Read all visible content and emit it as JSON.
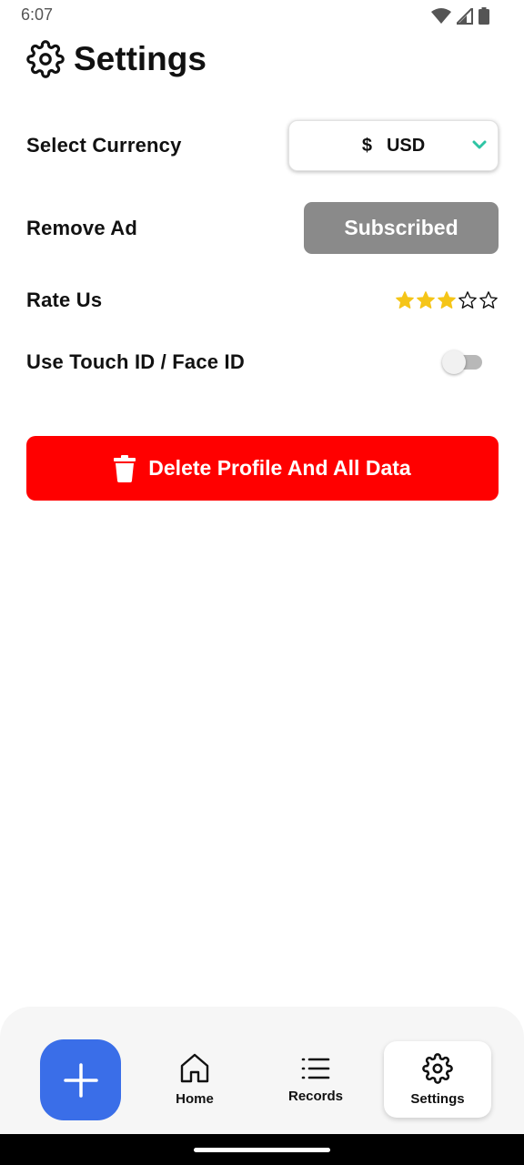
{
  "status_bar": {
    "time": "6:07",
    "icons": [
      "wifi-icon",
      "signal-icon",
      "battery-icon"
    ]
  },
  "header": {
    "icon": "gear-icon",
    "title": "Settings"
  },
  "settings": {
    "currency": {
      "label": "Select Currency",
      "symbol": "$",
      "code": "USD",
      "chevron_color": "#2ec4a4"
    },
    "remove_ad": {
      "label": "Remove Ad",
      "button_label": "Subscribed"
    },
    "rate_us": {
      "label": "Rate Us",
      "rating": 3,
      "max_rating": 5,
      "star_color": "#f5c518"
    },
    "touch_id": {
      "label": "Use Touch ID / Face ID",
      "enabled": false
    }
  },
  "delete_button": {
    "icon": "trash-icon",
    "label": "Delete Profile And All Data",
    "color": "#ff0000"
  },
  "bottom_nav": {
    "fab_icon": "plus-icon",
    "fab_color": "#3a6ee8",
    "items": [
      {
        "label": "Home",
        "icon": "home-icon",
        "active": false
      },
      {
        "label": "Records",
        "icon": "list-icon",
        "active": false
      },
      {
        "label": "Settings",
        "icon": "gear-icon",
        "active": true
      }
    ]
  }
}
